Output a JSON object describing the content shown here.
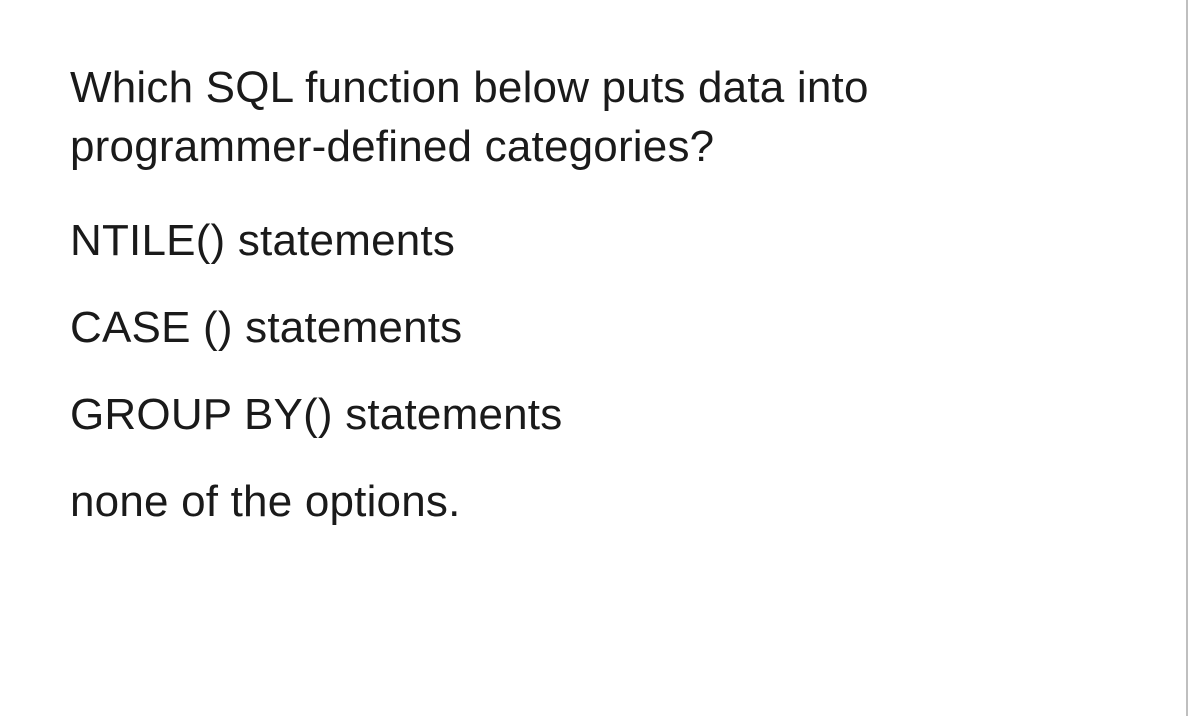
{
  "question": "Which SQL function below puts data into programmer-defined categories?",
  "options": [
    "NTILE() statements",
    "CASE () statements",
    "GROUP BY() statements",
    "none of the options."
  ]
}
